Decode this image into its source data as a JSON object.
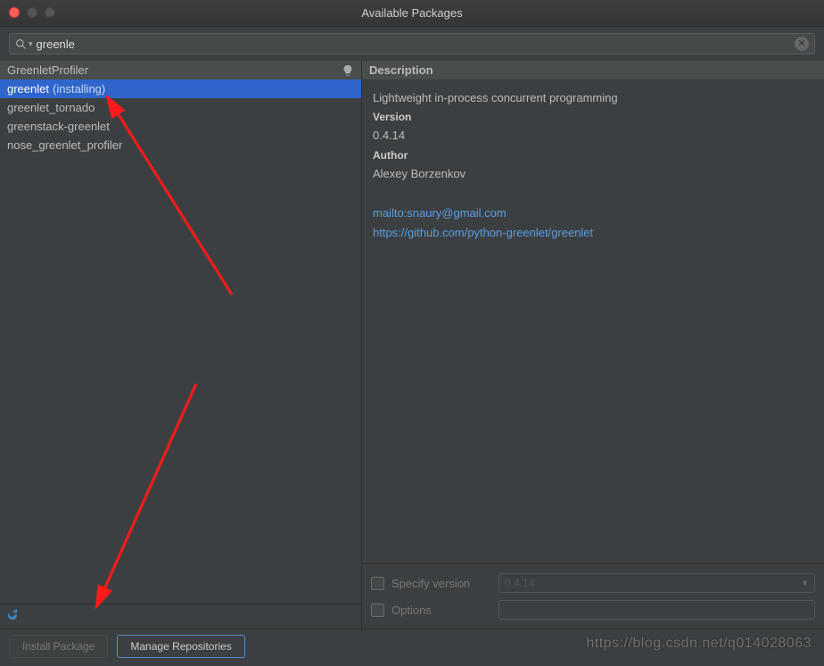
{
  "window": {
    "title": "Available Packages"
  },
  "search": {
    "value": "greenle",
    "clear_icon": "clear-icon"
  },
  "packages": [
    {
      "name": "GreenletProfiler",
      "status": "",
      "header": true
    },
    {
      "name": "greenlet",
      "status": "(installing)",
      "selected": true
    },
    {
      "name": "greenlet_tornado",
      "status": ""
    },
    {
      "name": "greenstack-greenlet",
      "status": ""
    },
    {
      "name": "nose_greenlet_profiler",
      "status": ""
    }
  ],
  "description": {
    "heading": "Description",
    "summary": "Lightweight in-process concurrent programming",
    "version_label": "Version",
    "version": "0.4.14",
    "author_label": "Author",
    "author": "Alexey Borzenkov",
    "email": "mailto:snaury@gmail.com",
    "url": "https://github.com/python-greenlet/greenlet"
  },
  "options": {
    "specify_version_label": "Specify version",
    "specify_version_value": "0.4.14",
    "options_label": "Options"
  },
  "buttons": {
    "install": "Install Package",
    "manage": "Manage Repositories"
  },
  "watermark": "https://blog.csdn.net/q014028063"
}
